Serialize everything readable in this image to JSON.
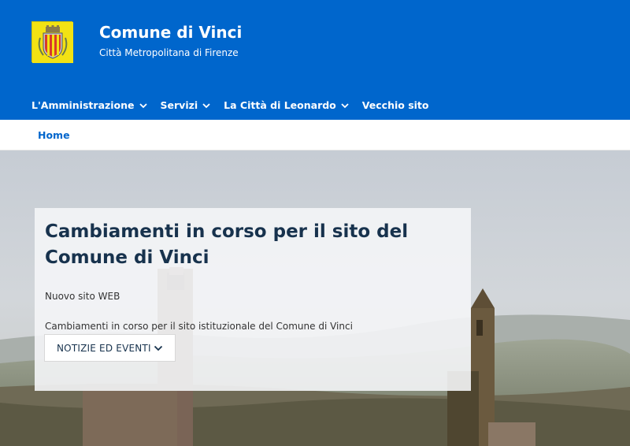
{
  "header": {
    "title": "Comune di Vinci",
    "subtitle": "Città Metropolitana di Firenze",
    "logo_icon": "coat-of-arms"
  },
  "nav": {
    "items": [
      {
        "label": "L'Amministrazione",
        "has_dropdown": true
      },
      {
        "label": "Servizi",
        "has_dropdown": true
      },
      {
        "label": "La Città di Leonardo",
        "has_dropdown": true
      },
      {
        "label": "Vecchio sito",
        "has_dropdown": false
      }
    ]
  },
  "breadcrumb": {
    "home_label": "Home"
  },
  "hero": {
    "title": "Cambiamenti in corso per il sito del Comune di Vinci",
    "kicker": "Nuovo sito WEB",
    "description": "Cambiamenti in corso per il sito istituzionale del Comune di Vinci",
    "dropdown_label": "NOTIZIE ED EVENTI",
    "dropdown_icon": "chevron-down-icon"
  },
  "colors": {
    "brand": "#0066cc",
    "title_text": "#17324d"
  }
}
